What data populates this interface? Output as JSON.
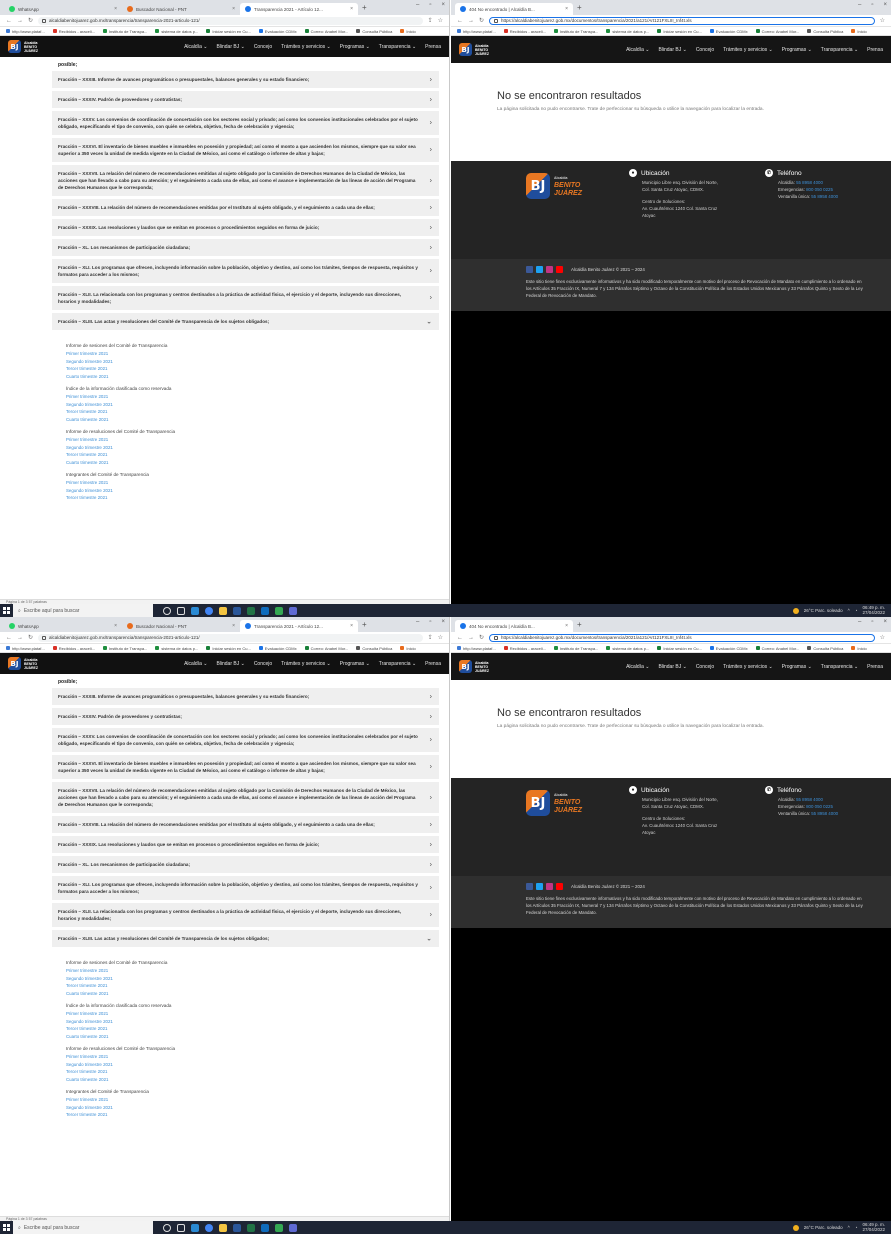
{
  "left_window": {
    "tabs": [
      {
        "label": "WhatsApp",
        "color": "#25d366",
        "active": false
      },
      {
        "label": "Buscador Nacional - PNT",
        "color": "#e86b1c",
        "active": false
      },
      {
        "label": "Transparencia 2021 - Artículo 12...",
        "color": "#1a73e8",
        "active": true
      }
    ],
    "url": "alcaldiabenitojuarez.gob.mx/transparencia/transparencia-2021-articulo-121/",
    "bookmarks": [
      {
        "label": "http://www.plataf...",
        "color": "#3c7ad6"
      },
      {
        "label": "Recibidos - araceli...",
        "color": "#d93025"
      },
      {
        "label": "Instituto de Transpa...",
        "color": "#1e8e3e"
      },
      {
        "label": "sistema de datos p...",
        "color": "#1e8e3e"
      },
      {
        "label": "Iniciar sesión en Cu...",
        "color": "#188038"
      },
      {
        "label": "Evaluación CDMx",
        "color": "#1a73e8"
      },
      {
        "label": "Correo: Anabel Mor...",
        "color": "#188038"
      },
      {
        "label": "Consulta Pública",
        "color": "#555555"
      },
      {
        "label": "Inicio",
        "color": "#e86b1c"
      }
    ],
    "menu": [
      "Alcaldía ⌄",
      "Blindar BJ ⌄",
      "Concejo",
      "Trámites y servicios ⌄",
      "Programas ⌄",
      "Transparencia ⌄",
      "Prensa"
    ],
    "possible_text": "posible;",
    "fractions": [
      {
        "text": "Fracción – XXXIII. Informe de avances programáticos o presupuestales, balances generales y su estado financiero;",
        "icon": "›"
      },
      {
        "text": "Fracción – XXXIV. Padrón de proveedores y contratistas;",
        "icon": "›"
      },
      {
        "text": "Fracción – XXXV. Los convenios de coordinación de concertación con los sectores social y privado; así como los convenios institucionales celebrados por el sujeto obligado, especificando el tipo de convenio, con quién se celebra, objetivo, fecha de celebración y vigencia;",
        "icon": "›"
      },
      {
        "text": "Fracción – XXXVI. El inventario de bienes muebles e inmuebles en posesión y propiedad; así como el monto a que ascienden los mismos, siempre que su valor sea superior a 350 veces la unidad de medida vigente en la Ciudad de México, así como el catálogo o informe de altas y bajas;",
        "icon": "›"
      },
      {
        "text": "Fracción – XXXVII. La relación del número de recomendaciones emitidas al sujeto obligado por la Comisión de Derechos Humanos de la Ciudad de México, las acciones que han llevado a cabo para su atención; y el seguimiento a cada una de ellas, así como el avance e implementación de las líneas de acción del Programa de Derechos Humanos que le corresponda;",
        "icon": "›"
      },
      {
        "text": "Fracción – XXXVIII. La relación del número de recomendaciones emitidas por el Instituto al sujeto obligado, y el seguimiento a cada una de ellas;",
        "icon": "›"
      },
      {
        "text": "Fracción – XXXIX. Las resoluciones y laudos que se emitan en procesos o procedimientos seguidos en forma de juicio;",
        "icon": "›"
      },
      {
        "text": "Fracción – XL. Los mecanismos de participación ciudadana;",
        "icon": "›"
      },
      {
        "text": "Fracción – XLI. Los programas que ofrecen, incluyendo información sobre la población, objetivo y destino, así como los trámites, tiempos de respuesta, requisitos y formatos para acceder a los mismos;",
        "icon": "›"
      },
      {
        "text": "Fracción – XLII. La relacionada con los programas y centros destinados a la práctica de actividad física, el ejercicio y el deporte, incluyendo sus direcciones, horarios y modalidades;",
        "icon": "›"
      },
      {
        "text": "Fracción – XLIII. Las actas y resoluciones del Comité de Transparencia de los sujetos obligados;",
        "icon": "⌄"
      }
    ],
    "groups": [
      {
        "title": "Informe de sesiones del Comité de Transparencia",
        "links": [
          "Primer trimestre 2021",
          "Segundo trimestre 2021",
          "Tercer trimestre 2021",
          "Cuarto trimestre 2021"
        ]
      },
      {
        "title": "Índice de la información clasificada como reservada",
        "links": [
          "Primer trimestre 2021",
          "Segundo trimestre 2021",
          "Tercer trimestre 2021",
          "Cuarto trimestre 2021"
        ]
      },
      {
        "title": "Informe de resoluciones del Comité de Transparencia",
        "links": [
          "Primer trimestre 2021",
          "Segundo trimestre 2021",
          "Tercer trimestre 2021",
          "Cuarto trimestre 2021"
        ]
      },
      {
        "title": "Integrantes del Comité de Transparencia",
        "links": [
          "Primer trimestre 2021",
          "Segundo trimestre 2021",
          "Tercer trimestre 2021"
        ]
      }
    ],
    "statusbar": "Página 1 de 3    57 palabras"
  },
  "right_window": {
    "tab_label": "404 No encontrado | Alcaldía B...",
    "url": "https://alcaldiabenitojuarez.gob.mx/documentos/transparencia/2021/a121/Art121FXLIII_Inf4t.xls",
    "menu": [
      "Alcaldía ⌄",
      "Blindar BJ ⌄",
      "Concejo",
      "Trámites y servicios ⌄",
      "Programas ⌄",
      "Transparencia ⌄",
      "Prensa"
    ],
    "not_found_title": "No se encontraron resultados",
    "not_found_text": "La página solicitada no pudo encontrarse. Trate de perfeccionar su búsqueda o utilice la navegación para localizar la entrada.",
    "footer": {
      "logo_small": "Alcaldía",
      "logo_line1": "BENITO",
      "logo_line2": "JUÁREZ",
      "location_title": "Ubicación",
      "location_lines": [
        "Municipio Libre esq. División del Norte,",
        "Col. Santa Cruz Atoyac, CDMX."
      ],
      "solutions_lines": [
        "Centro de Soluciones:",
        "Av. Cuauhtémoc 1240 Col. Santa Cruz",
        "Atoyac"
      ],
      "phone_title": "Teléfono",
      "phones": [
        {
          "label": "Alcaldía:",
          "value": "55 8958 4000"
        },
        {
          "label": "Emergencias:",
          "value": "800 050 0225"
        },
        {
          "label": "Ventanilla única:",
          "value": "55 8958 4000"
        }
      ],
      "copyright": "Alcaldía Benito Juárez © 2021 – 2024",
      "notice": "Este sitio tiene fines exclusivamente informativos y ha sido modificado temporalmente con motivo del proceso de Revocación de Mandato en cumplimiento a lo ordenado en los Artículos 35 Fracción IX, Numeral 7 y 134 Párrafos Séptimo y Octavo de la Constitución Política de los Estados Unidos Mexicanos y 33 Párrafos Quinto y Sexto de la Ley Federal de Revocación de Mandato."
    }
  },
  "taskbar": {
    "search_placeholder": "Escribe aquí para buscar",
    "weather": "26°C  Parc. soleado",
    "time": "06:49 p. m.",
    "date": "27/04/2022"
  }
}
